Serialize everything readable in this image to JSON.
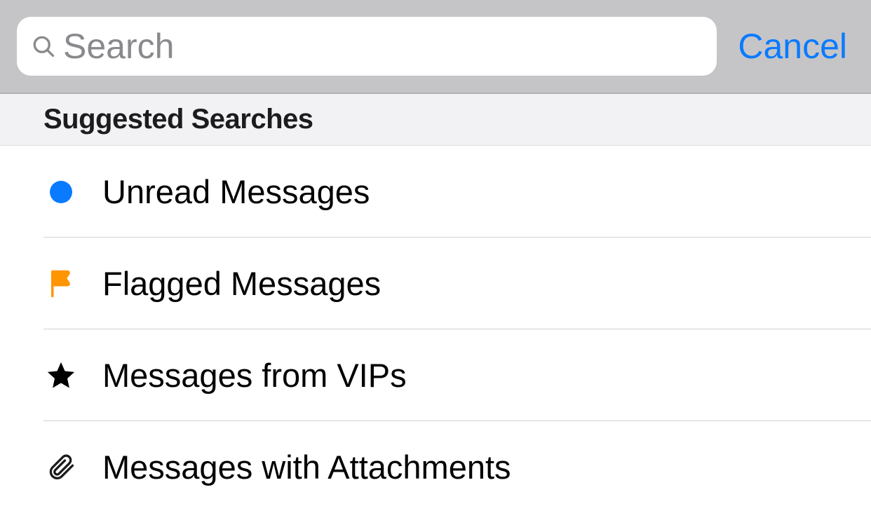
{
  "search": {
    "placeholder": "Search",
    "cancel_label": "Cancel"
  },
  "section_header": "Suggested Searches",
  "suggestions": [
    {
      "icon": "unread-dot-icon",
      "label": "Unread Messages"
    },
    {
      "icon": "flag-icon",
      "label": "Flagged Messages"
    },
    {
      "icon": "star-icon",
      "label": "Messages from VIPs"
    },
    {
      "icon": "paperclip-icon",
      "label": "Messages with Attachments"
    }
  ],
  "colors": {
    "accent_blue": "#0a7aff",
    "flag_orange": "#ff9500",
    "star_black": "#000000",
    "paperclip_gray": "#1c1c1e"
  }
}
